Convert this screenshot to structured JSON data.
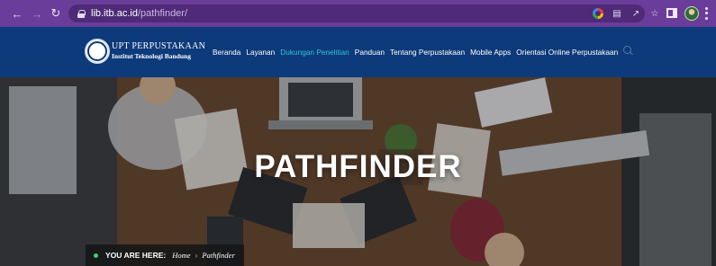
{
  "browser": {
    "url_host": "lib.itb.ac.id",
    "url_path": "/pathfinder/",
    "icons": [
      "back-arrow-icon",
      "forward-arrow-icon",
      "reload-icon",
      "lock-icon",
      "google-lens-icon",
      "translate-icon",
      "share-icon",
      "bookmark-star-icon",
      "side-panel-icon",
      "profile-avatar",
      "kebab-menu-icon"
    ]
  },
  "site": {
    "logo_line1": "UPT PERPUSTAKAAN",
    "logo_line2": "Institut Teknologi Bandung",
    "nav": [
      "Beranda",
      "Layanan",
      "Dukungan Penelitian",
      "Panduan",
      "Tentang Perpustakaan",
      "Mobile Apps",
      "Orientasi Online Perpustakaan"
    ],
    "active_nav_index": 2,
    "colors": {
      "header_bg": "#0d3a7a",
      "active_nav": "#34c3d8",
      "chrome": "#6a3d9a"
    }
  },
  "hero": {
    "title": "PATHFINDER",
    "breadcrumb_label": "YOU ARE HERE:",
    "breadcrumb_home": "Home",
    "breadcrumb_separator": "›",
    "breadcrumb_current": "Pathfinder"
  }
}
